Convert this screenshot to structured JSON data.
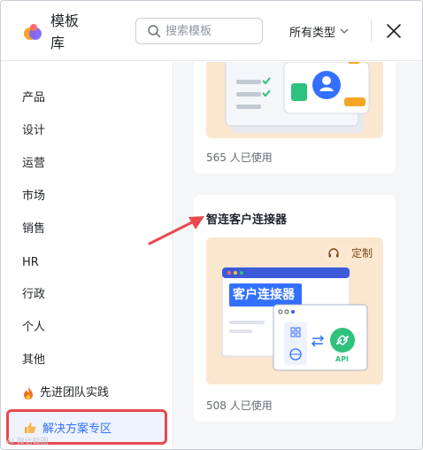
{
  "header": {
    "title": "模板库",
    "search_placeholder": "搜索模板",
    "type_select_label": "所有类型"
  },
  "sidebar": {
    "items": [
      {
        "label": "产品"
      },
      {
        "label": "设计"
      },
      {
        "label": "运营"
      },
      {
        "label": "市场"
      },
      {
        "label": "销售"
      },
      {
        "label": "HR"
      },
      {
        "label": "行政"
      },
      {
        "label": "个人"
      },
      {
        "label": "其他"
      },
      {
        "label": "先进团队实践",
        "icon": "fire-icon"
      },
      {
        "label": "解决方案专区",
        "icon": "thumbs-up-icon",
        "selected": true
      }
    ]
  },
  "templates": [
    {
      "usage": "565 人已使用"
    },
    {
      "title": "智连客户连接器",
      "badge": "定制",
      "usage": "508 人已使用",
      "thumb": {
        "heading": "客户连接器",
        "api_label": "API"
      }
    }
  ],
  "colors": {
    "accent": "#3370ff",
    "highlight_border": "#e8494e",
    "thumb_bg": "#fbe6cf",
    "api_green": "#2fc17e"
  },
  "watermark": "AI 微信截图"
}
